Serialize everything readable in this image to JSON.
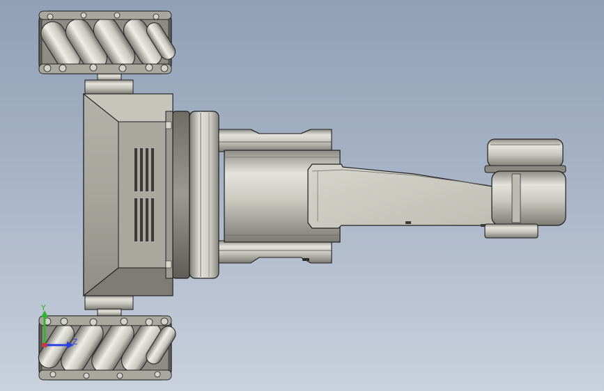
{
  "viewport": {
    "background_top": "#90a0b6",
    "background_bottom": "#c9d1dd"
  },
  "model": {
    "part_color": "#d2d1c8",
    "edge_color": "#2a2a2a",
    "visible_parts": [
      "top-mecanum-wheel",
      "bottom-mecanum-wheel",
      "robot-base-body",
      "arm-joint-flange",
      "arm-upper-link",
      "arm-forearm-link",
      "arm-end-effector"
    ]
  },
  "triad": {
    "y_label": "Y",
    "z_label": "Z",
    "y_color": "#2fb52f",
    "z_color": "#2a3fe0"
  }
}
